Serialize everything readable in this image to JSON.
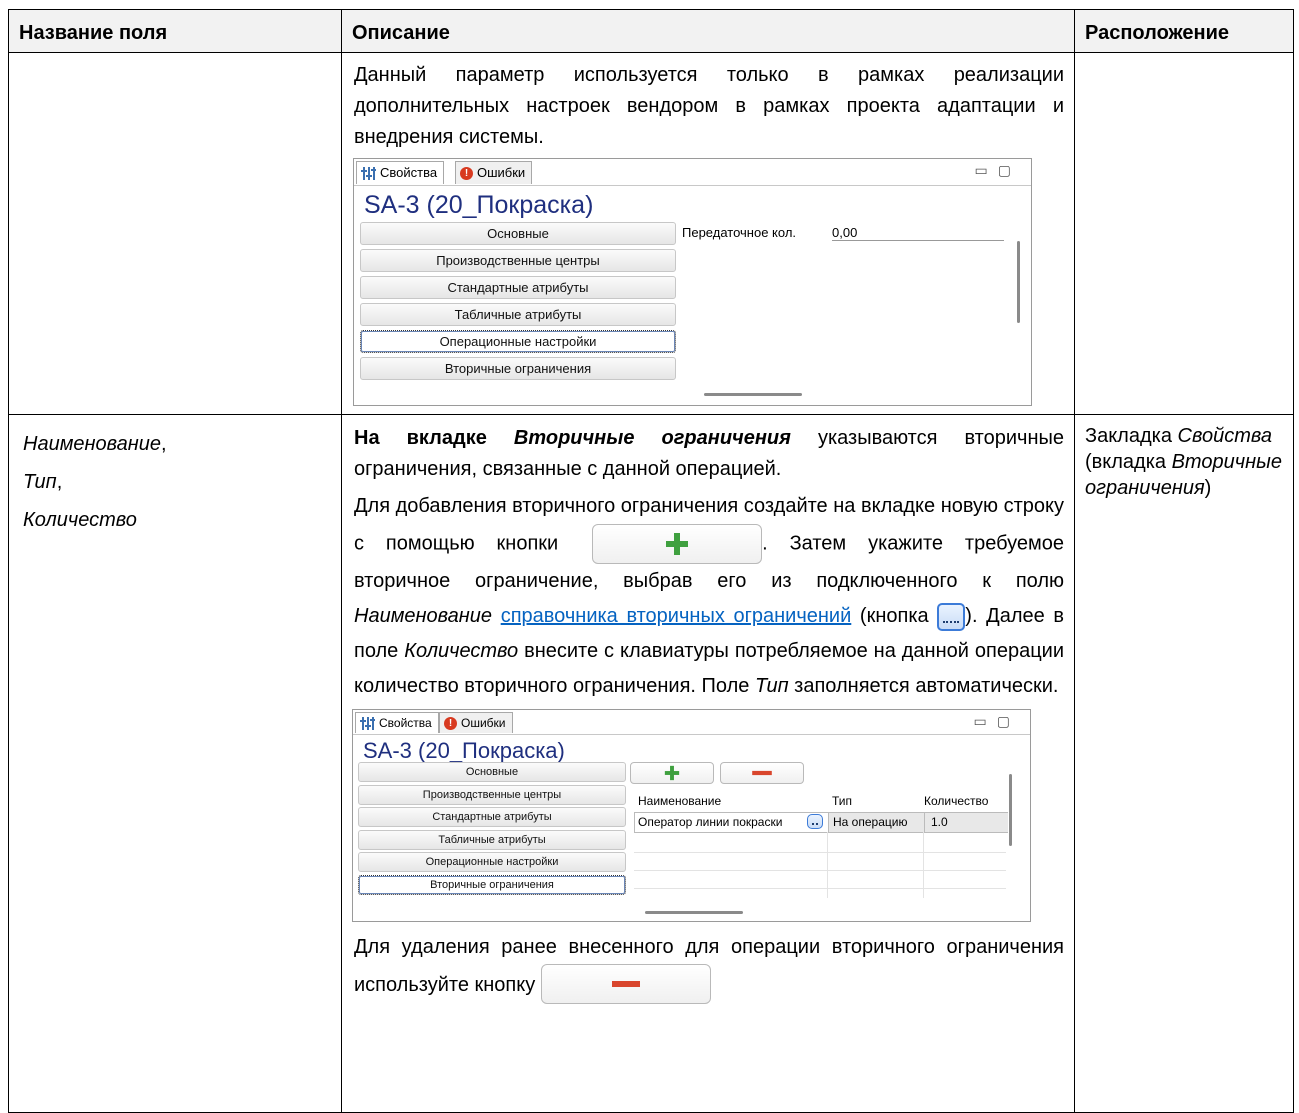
{
  "headers": {
    "col1": "Название поля",
    "col2": "Описание",
    "col3": "Расположение"
  },
  "row1": {
    "description": "Данный параметр используется только в рамках реализации дополнительных настроек вендором в рамках проекта адаптации и внедрения системы.",
    "window": {
      "tab_properties": "Свойства",
      "tab_errors": "Ошибки",
      "title": "SA-3 (20_Покраска)",
      "buttons": [
        "Основные",
        "Производственные центры",
        "Стандартные атрибуты",
        "Табличные атрибуты",
        "Операционные настройки",
        "Вторичные ограничения"
      ],
      "field_label": "Передаточное кол.",
      "field_value": "0,00"
    }
  },
  "row2": {
    "fields": [
      "Наименование",
      "Тип",
      "Количество"
    ],
    "location_prefix": "Закладка ",
    "location_tab": "Свойства",
    "location_open": " (вкладка ",
    "location_subtab": "Вторичные ограничения",
    "location_close": ")",
    "p1_bold": "На вкладке ",
    "p1_bold_italic": "Вторичные ограничения",
    "p1_rest": " указываются вторичные ограничения, связанные с данной операцией.",
    "p2_a": "Для добавления вторичного ограничения создайте на вкладке новую строку с помощью кнопки",
    "p2_b": ". Затем укажите требуемое вторичное ограничение, выбрав его из подключенного к полю ",
    "p2_italic1": "Наименование",
    "p2_link": "справочника вторичных ограничений",
    "p2_c": " (кнопка ",
    "p2_d": "). Далее в поле ",
    "p2_italic2": "Количество",
    "p2_e": " внесите с клавиатуры потребляемое на данной операции количество вторичного ограничения. Поле ",
    "p2_italic3": "Тип",
    "p2_f": " заполняется автоматически.",
    "window": {
      "tab_properties": "Свойства",
      "tab_errors": "Ошибки",
      "title": "SA-3 (20_Покраска)",
      "buttons": [
        "Основные",
        "Производственные центры",
        "Стандартные атрибуты",
        "Табличные атрибуты",
        "Операционные настройки",
        "Вторичные ограничения"
      ],
      "grid_headers": [
        "Наименование",
        "Тип",
        "Количество"
      ],
      "grid_row": [
        "Оператор линии покраски",
        "На операцию",
        "1.0"
      ]
    },
    "p3": "Для удаления ранее внесенного для операции вторичного ограничения используйте кнопку"
  },
  "icons": {
    "add": "plus-icon",
    "remove": "minus-icon",
    "lookup": "ellipsis-button-icon"
  },
  "colors": {
    "link": "#0563c1",
    "title": "#1f2f7f",
    "plus": "#3fa03f",
    "minus": "#d9462d"
  }
}
